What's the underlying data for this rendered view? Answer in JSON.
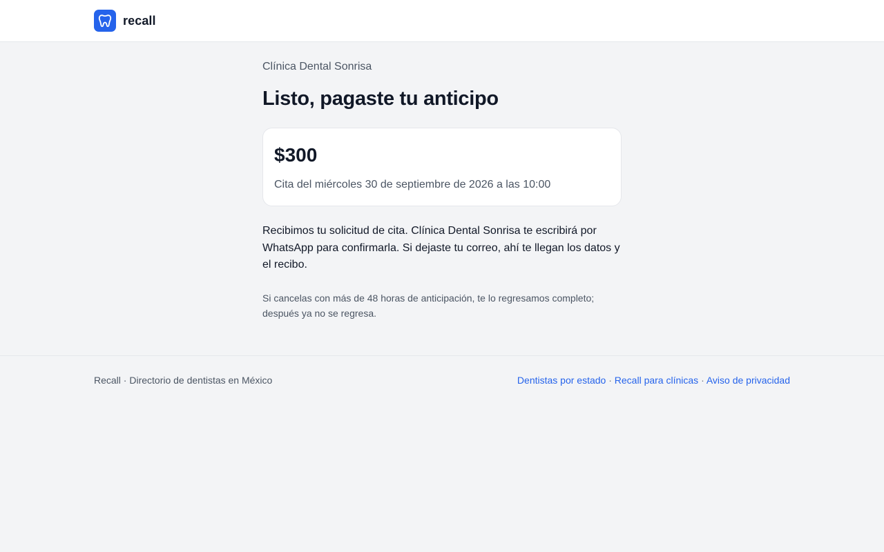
{
  "header": {
    "brand_name": "recall",
    "logo_icon": "tooth-icon",
    "accent_color": "#2563eb"
  },
  "main": {
    "clinic_name": "Clínica Dental Sonrisa",
    "title": "Listo, pagaste tu anticipo",
    "card": {
      "amount": "$300",
      "appointment": "Cita del miércoles 30 de septiembre de 2026 a las 10:00"
    },
    "message": "Recibimos tu solicitud de cita. Clínica Dental Sonrisa te escribirá por WhatsApp para confirmarla. Si dejaste tu correo, ahí te llegan los datos y el recibo.",
    "policy": "Si cancelas con más de 48 horas de anticipación, te lo regresamos completo; después ya no se regresa."
  },
  "footer": {
    "left_text": "Recall · Directorio de dentistas en México",
    "separator": "·",
    "links": [
      {
        "label": "Dentistas por estado"
      },
      {
        "label": "Recall para clínicas"
      },
      {
        "label": "Aviso de privacidad"
      }
    ]
  }
}
